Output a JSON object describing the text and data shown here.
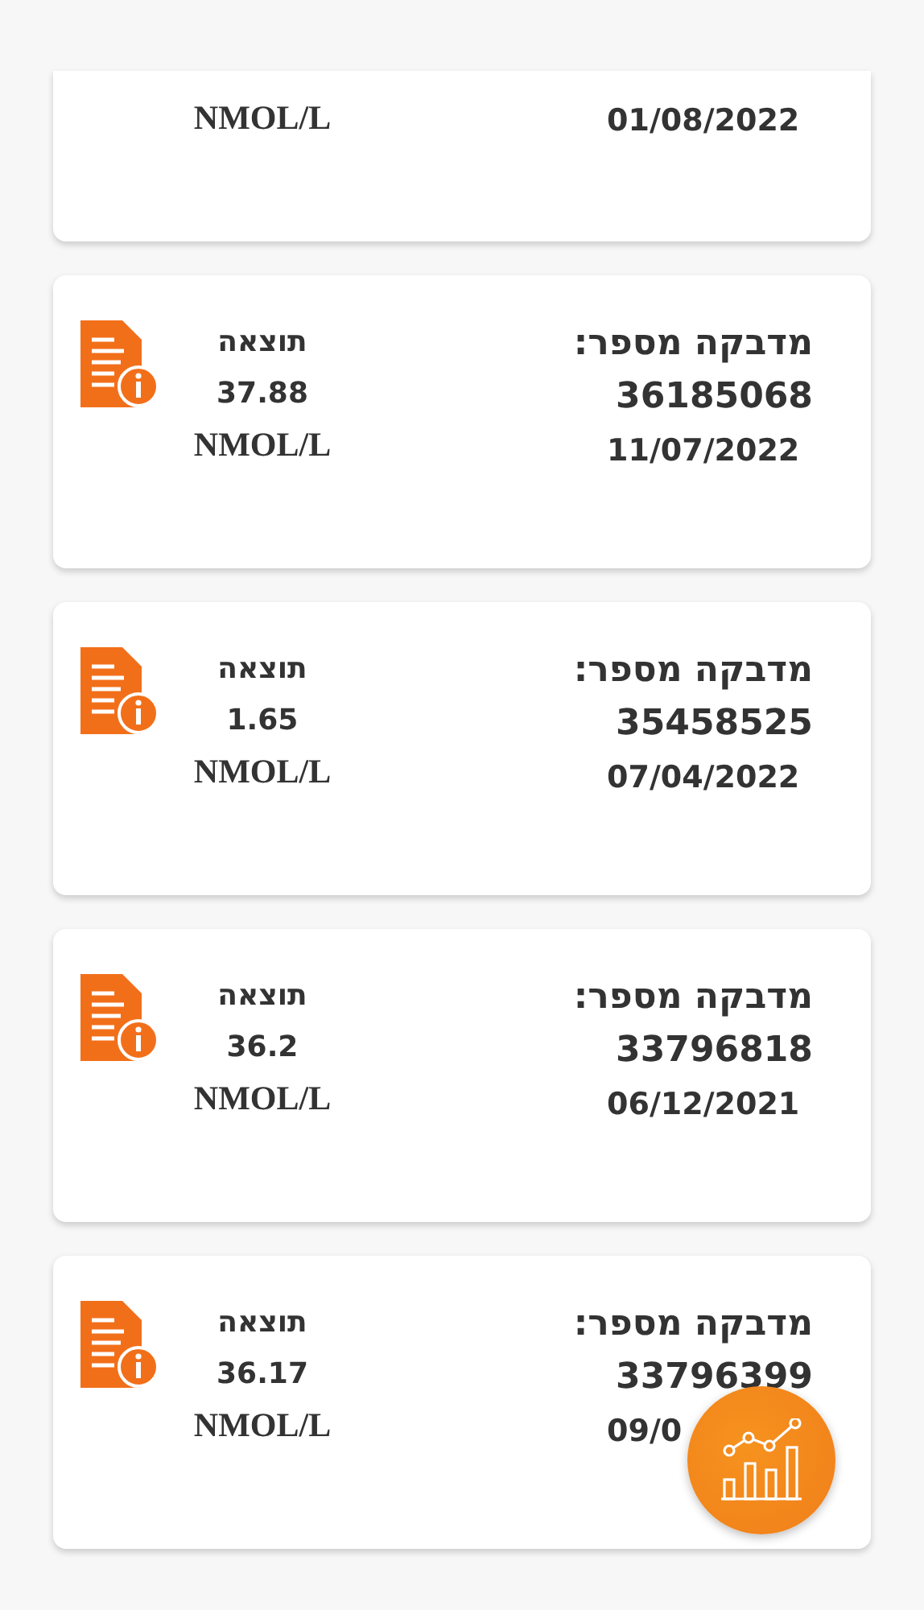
{
  "cards": [
    {
      "kind": "partial",
      "date": "01/08/2022",
      "unit": "NMOL/L"
    },
    {
      "kind": "full",
      "title": "מדבקה מספר:",
      "number": "36185068",
      "date": "11/07/2022",
      "result_label": "תוצאה",
      "value": "37.88",
      "unit": "NMOL/L"
    },
    {
      "kind": "full",
      "title": "מדבקה מספר:",
      "number": "35458525",
      "date": "07/04/2022",
      "result_label": "תוצאה",
      "value": "1.65",
      "unit": "NMOL/L"
    },
    {
      "kind": "full",
      "title": "מדבקה מספר:",
      "number": "33796818",
      "date": "06/12/2021",
      "result_label": "תוצאה",
      "value": "36.2",
      "unit": "NMOL/L"
    },
    {
      "kind": "full",
      "title": "מדבקה מספר:",
      "number": "33796399",
      "date": "09/0",
      "result_label": "תוצאה",
      "value": "36.17",
      "unit": "NMOL/L"
    }
  ]
}
